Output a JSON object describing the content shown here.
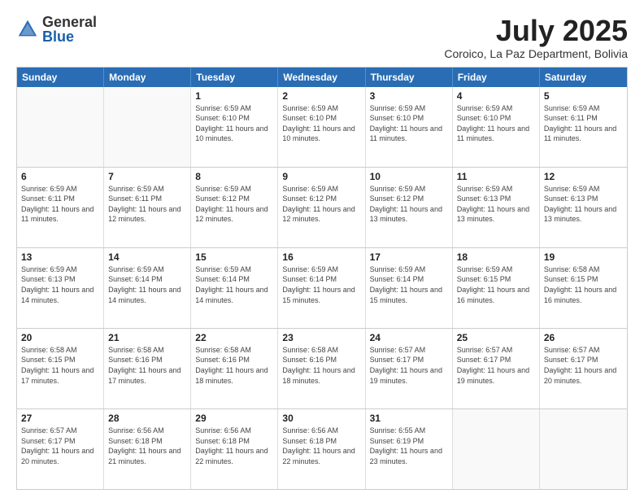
{
  "logo": {
    "general": "General",
    "blue": "Blue"
  },
  "title": "July 2025",
  "location": "Coroico, La Paz Department, Bolivia",
  "header_days": [
    "Sunday",
    "Monday",
    "Tuesday",
    "Wednesday",
    "Thursday",
    "Friday",
    "Saturday"
  ],
  "weeks": [
    [
      {
        "day": "",
        "empty": true
      },
      {
        "day": "",
        "empty": true
      },
      {
        "day": "1",
        "sunrise": "6:59 AM",
        "sunset": "6:10 PM",
        "daylight": "11 hours and 10 minutes."
      },
      {
        "day": "2",
        "sunrise": "6:59 AM",
        "sunset": "6:10 PM",
        "daylight": "11 hours and 10 minutes."
      },
      {
        "day": "3",
        "sunrise": "6:59 AM",
        "sunset": "6:10 PM",
        "daylight": "11 hours and 11 minutes."
      },
      {
        "day": "4",
        "sunrise": "6:59 AM",
        "sunset": "6:10 PM",
        "daylight": "11 hours and 11 minutes."
      },
      {
        "day": "5",
        "sunrise": "6:59 AM",
        "sunset": "6:11 PM",
        "daylight": "11 hours and 11 minutes."
      }
    ],
    [
      {
        "day": "6",
        "sunrise": "6:59 AM",
        "sunset": "6:11 PM",
        "daylight": "11 hours and 11 minutes."
      },
      {
        "day": "7",
        "sunrise": "6:59 AM",
        "sunset": "6:11 PM",
        "daylight": "11 hours and 12 minutes."
      },
      {
        "day": "8",
        "sunrise": "6:59 AM",
        "sunset": "6:12 PM",
        "daylight": "11 hours and 12 minutes."
      },
      {
        "day": "9",
        "sunrise": "6:59 AM",
        "sunset": "6:12 PM",
        "daylight": "11 hours and 12 minutes."
      },
      {
        "day": "10",
        "sunrise": "6:59 AM",
        "sunset": "6:12 PM",
        "daylight": "11 hours and 13 minutes."
      },
      {
        "day": "11",
        "sunrise": "6:59 AM",
        "sunset": "6:13 PM",
        "daylight": "11 hours and 13 minutes."
      },
      {
        "day": "12",
        "sunrise": "6:59 AM",
        "sunset": "6:13 PM",
        "daylight": "11 hours and 13 minutes."
      }
    ],
    [
      {
        "day": "13",
        "sunrise": "6:59 AM",
        "sunset": "6:13 PM",
        "daylight": "11 hours and 14 minutes."
      },
      {
        "day": "14",
        "sunrise": "6:59 AM",
        "sunset": "6:14 PM",
        "daylight": "11 hours and 14 minutes."
      },
      {
        "day": "15",
        "sunrise": "6:59 AM",
        "sunset": "6:14 PM",
        "daylight": "11 hours and 14 minutes."
      },
      {
        "day": "16",
        "sunrise": "6:59 AM",
        "sunset": "6:14 PM",
        "daylight": "11 hours and 15 minutes."
      },
      {
        "day": "17",
        "sunrise": "6:59 AM",
        "sunset": "6:14 PM",
        "daylight": "11 hours and 15 minutes."
      },
      {
        "day": "18",
        "sunrise": "6:59 AM",
        "sunset": "6:15 PM",
        "daylight": "11 hours and 16 minutes."
      },
      {
        "day": "19",
        "sunrise": "6:58 AM",
        "sunset": "6:15 PM",
        "daylight": "11 hours and 16 minutes."
      }
    ],
    [
      {
        "day": "20",
        "sunrise": "6:58 AM",
        "sunset": "6:15 PM",
        "daylight": "11 hours and 17 minutes."
      },
      {
        "day": "21",
        "sunrise": "6:58 AM",
        "sunset": "6:16 PM",
        "daylight": "11 hours and 17 minutes."
      },
      {
        "day": "22",
        "sunrise": "6:58 AM",
        "sunset": "6:16 PM",
        "daylight": "11 hours and 18 minutes."
      },
      {
        "day": "23",
        "sunrise": "6:58 AM",
        "sunset": "6:16 PM",
        "daylight": "11 hours and 18 minutes."
      },
      {
        "day": "24",
        "sunrise": "6:57 AM",
        "sunset": "6:17 PM",
        "daylight": "11 hours and 19 minutes."
      },
      {
        "day": "25",
        "sunrise": "6:57 AM",
        "sunset": "6:17 PM",
        "daylight": "11 hours and 19 minutes."
      },
      {
        "day": "26",
        "sunrise": "6:57 AM",
        "sunset": "6:17 PM",
        "daylight": "11 hours and 20 minutes."
      }
    ],
    [
      {
        "day": "27",
        "sunrise": "6:57 AM",
        "sunset": "6:17 PM",
        "daylight": "11 hours and 20 minutes."
      },
      {
        "day": "28",
        "sunrise": "6:56 AM",
        "sunset": "6:18 PM",
        "daylight": "11 hours and 21 minutes."
      },
      {
        "day": "29",
        "sunrise": "6:56 AM",
        "sunset": "6:18 PM",
        "daylight": "11 hours and 22 minutes."
      },
      {
        "day": "30",
        "sunrise": "6:56 AM",
        "sunset": "6:18 PM",
        "daylight": "11 hours and 22 minutes."
      },
      {
        "day": "31",
        "sunrise": "6:55 AM",
        "sunset": "6:19 PM",
        "daylight": "11 hours and 23 minutes."
      },
      {
        "day": "",
        "empty": true
      },
      {
        "day": "",
        "empty": true
      }
    ]
  ]
}
